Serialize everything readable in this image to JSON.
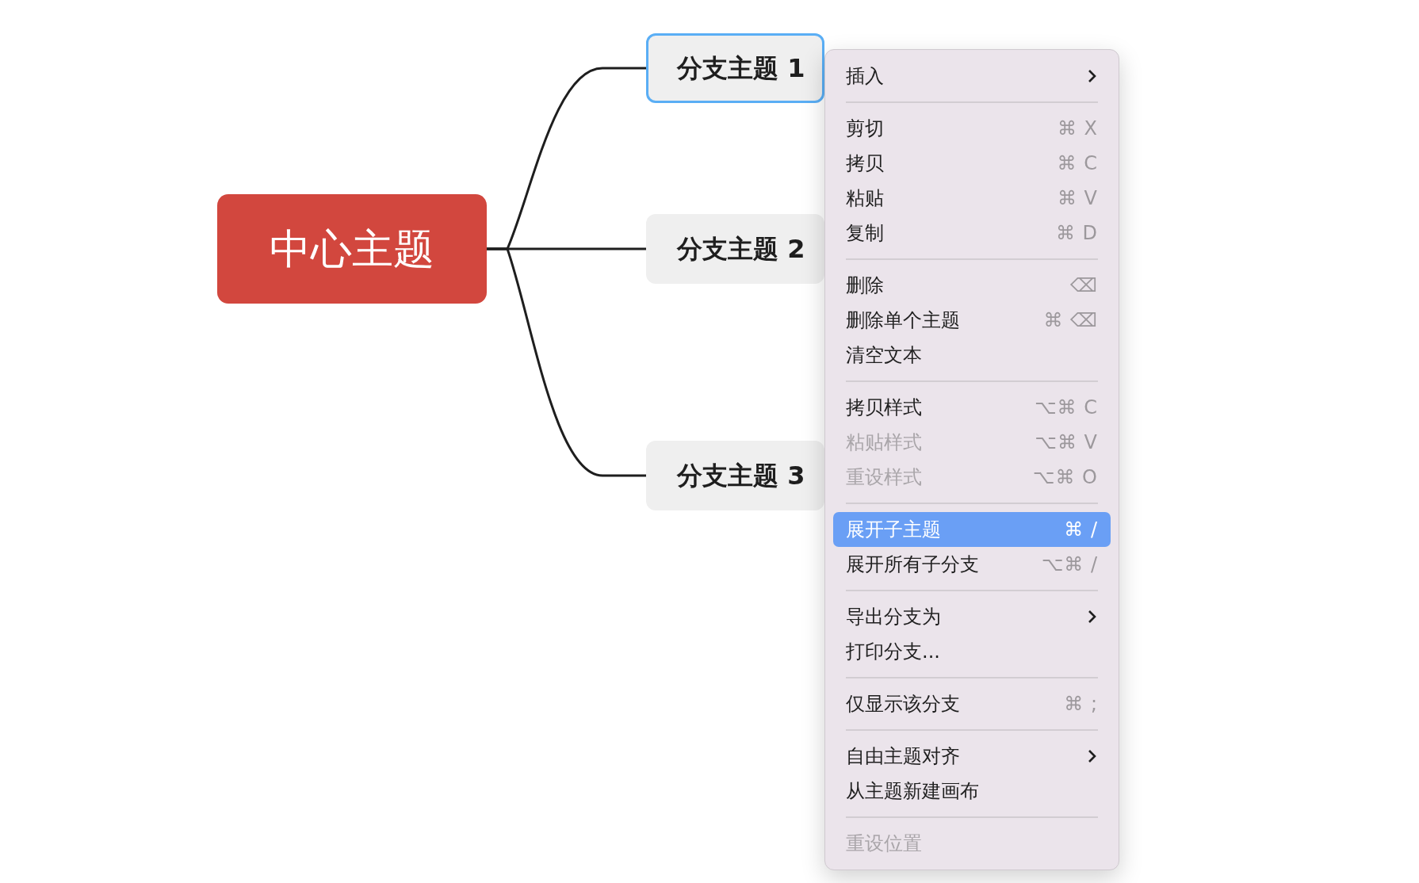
{
  "mindmap": {
    "central_topic": "中心主题",
    "branches": [
      {
        "label": "分支主题 1",
        "selected": true
      },
      {
        "label": "分支主题 2",
        "selected": false
      },
      {
        "label": "分支主题 3",
        "selected": false
      }
    ]
  },
  "context_menu": {
    "sections": [
      {
        "items": [
          {
            "label": "插入",
            "kind": "submenu",
            "disabled": false,
            "selected": false
          }
        ]
      },
      {
        "items": [
          {
            "label": "剪切",
            "kind": "item",
            "shortcut": "⌘ X",
            "disabled": false,
            "selected": false
          },
          {
            "label": "拷贝",
            "kind": "item",
            "shortcut": "⌘ C",
            "disabled": false,
            "selected": false
          },
          {
            "label": "粘贴",
            "kind": "item",
            "shortcut": "⌘ V",
            "disabled": false,
            "selected": false
          },
          {
            "label": "复制",
            "kind": "item",
            "shortcut": "⌘ D",
            "disabled": false,
            "selected": false
          }
        ]
      },
      {
        "items": [
          {
            "label": "删除",
            "kind": "item",
            "shortcut": "⌫",
            "disabled": false,
            "selected": false
          },
          {
            "label": "删除单个主题",
            "kind": "item",
            "shortcut": "⌘ ⌫",
            "disabled": false,
            "selected": false
          },
          {
            "label": "清空文本",
            "kind": "item",
            "disabled": false,
            "selected": false
          }
        ]
      },
      {
        "items": [
          {
            "label": "拷贝样式",
            "kind": "item",
            "shortcut": "⌥⌘ C",
            "disabled": false,
            "selected": false
          },
          {
            "label": "粘贴样式",
            "kind": "item",
            "shortcut": "⌥⌘ V",
            "disabled": true,
            "selected": false
          },
          {
            "label": "重设样式",
            "kind": "item",
            "shortcut": "⌥⌘ O",
            "disabled": true,
            "selected": false
          }
        ]
      },
      {
        "items": [
          {
            "label": "展开子主题",
            "kind": "item",
            "shortcut": "⌘ /",
            "disabled": false,
            "selected": true
          },
          {
            "label": "展开所有子分支",
            "kind": "item",
            "shortcut": "⌥⌘ /",
            "disabled": false,
            "selected": false
          }
        ]
      },
      {
        "items": [
          {
            "label": "导出分支为",
            "kind": "submenu",
            "disabled": false,
            "selected": false
          },
          {
            "label": "打印分支...",
            "kind": "item",
            "disabled": false,
            "selected": false
          }
        ]
      },
      {
        "items": [
          {
            "label": "仅显示该分支",
            "kind": "item",
            "shortcut": "⌘ ;",
            "disabled": false,
            "selected": false
          }
        ]
      },
      {
        "items": [
          {
            "label": "自由主题对齐",
            "kind": "submenu",
            "disabled": false,
            "selected": false
          },
          {
            "label": "从主题新建画布",
            "kind": "item",
            "disabled": false,
            "selected": false
          }
        ]
      },
      {
        "items": [
          {
            "label": "重设位置",
            "kind": "item",
            "disabled": true,
            "selected": false
          }
        ]
      }
    ]
  }
}
